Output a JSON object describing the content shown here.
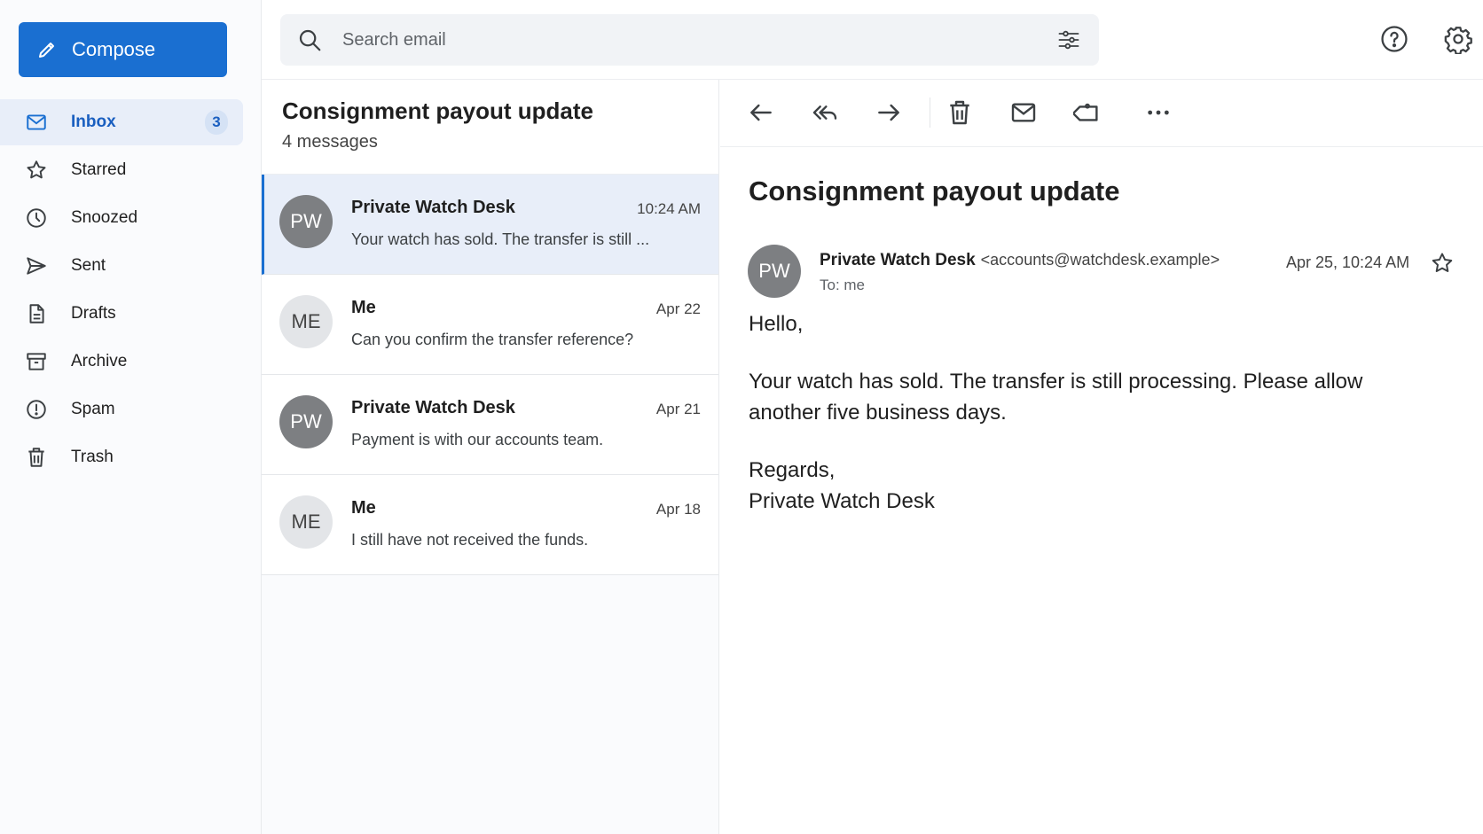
{
  "compose": {
    "label": "Compose"
  },
  "sidebar": {
    "items": [
      {
        "label": "Inbox",
        "icon": "mail-icon",
        "badge": "3",
        "active": true
      },
      {
        "label": "Starred",
        "icon": "star-icon"
      },
      {
        "label": "Snoozed",
        "icon": "clock-icon"
      },
      {
        "label": "Sent",
        "icon": "send-icon"
      },
      {
        "label": "Drafts",
        "icon": "draft-icon"
      },
      {
        "label": "Archive",
        "icon": "archive-icon"
      },
      {
        "label": "Spam",
        "icon": "spam-icon"
      },
      {
        "label": "Trash",
        "icon": "trash-icon"
      }
    ]
  },
  "search": {
    "placeholder": "Search email"
  },
  "thread": {
    "title": "Consignment payout update",
    "count": "4 messages",
    "messages": [
      {
        "initials": "PW",
        "sender": "Private Watch Desk",
        "date": "10:24 AM",
        "snippet": "Your watch has sold. The transfer is still ...",
        "selected": true
      },
      {
        "initials": "ME",
        "sender": "Me",
        "date": "Apr 22",
        "snippet": "Can you confirm the transfer reference?"
      },
      {
        "initials": "PW",
        "sender": "Private Watch Desk",
        "date": "Apr 21",
        "snippet": "Payment is with our accounts team."
      },
      {
        "initials": "ME",
        "sender": "Me",
        "date": "Apr 18",
        "snippet": "I still have not received the funds."
      }
    ]
  },
  "reader": {
    "subject": "Consignment payout update",
    "initials": "PW",
    "from_name": "Private Watch Desk",
    "from_address": "<accounts@watchdesk.example>",
    "to": "To: me",
    "date": "Apr 25, 10:24 AM",
    "body": {
      "greeting": "Hello,",
      "paragraph": "Your watch has sold. The transfer is still processing. Please allow another five business days.",
      "closing": "Regards,",
      "signature": "Private Watch Desk"
    }
  },
  "colors": {
    "accent": "#1a6fd1",
    "selected_bg": "#e8eef9"
  }
}
